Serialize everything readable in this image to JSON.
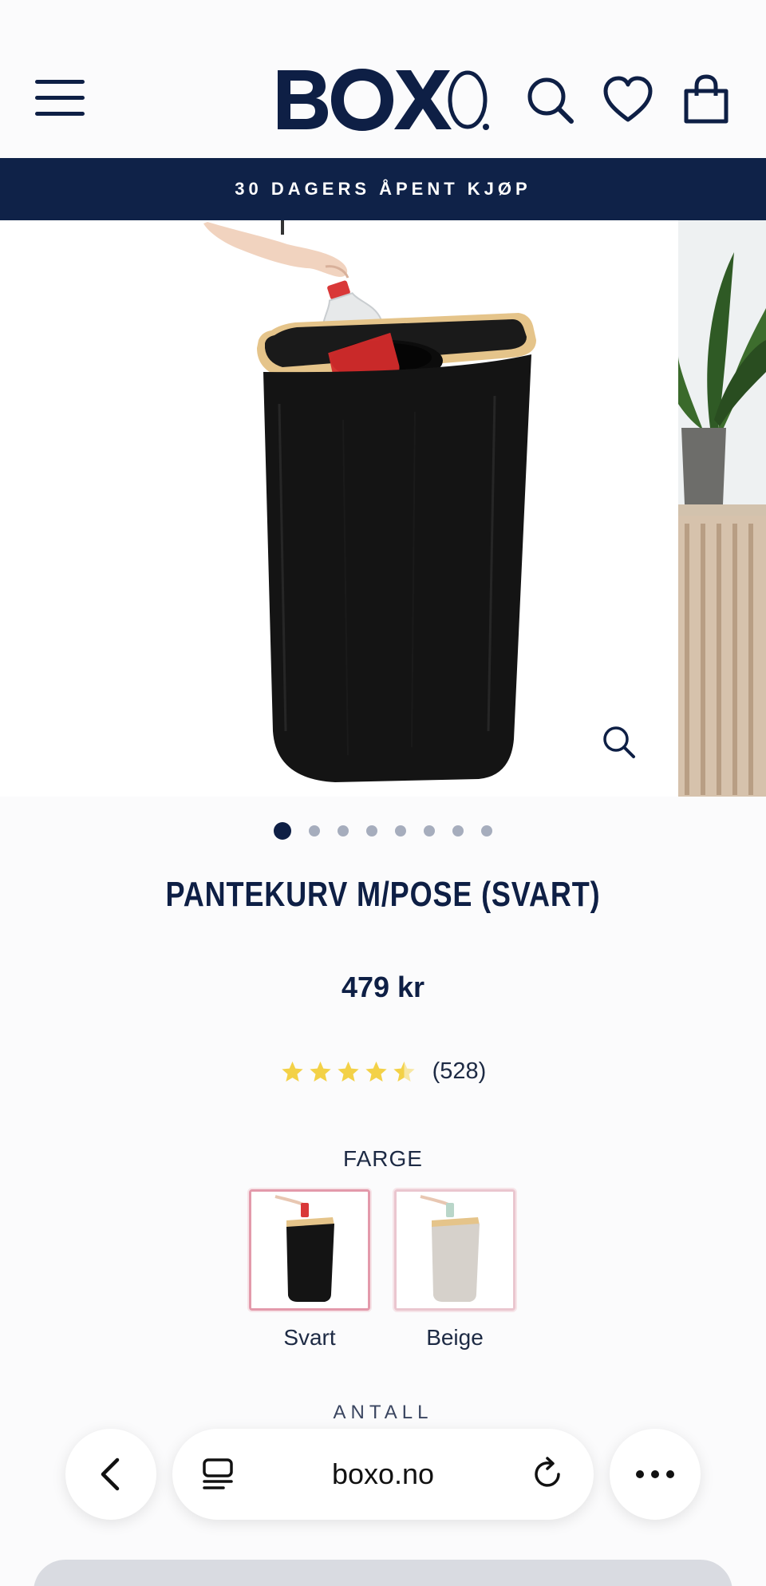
{
  "header": {
    "logo_text": "BOXO",
    "menu_icon": "hamburger-menu-icon",
    "search_icon": "search-icon",
    "wishlist_icon": "heart-icon",
    "cart_icon": "shopping-bag-icon"
  },
  "banner": {
    "text": "30 DAGERS ÅPENT KJØP"
  },
  "gallery": {
    "image_count": 8,
    "active_index": 0,
    "zoom_icon": "zoom-icon"
  },
  "product": {
    "title": "PANTEKURV M/POSE (SVART)",
    "price": "479 kr",
    "rating": 4.5,
    "review_count": "(528)"
  },
  "color_option": {
    "label": "FARGE",
    "options": [
      {
        "label": "Svart",
        "selected": true
      },
      {
        "label": "Beige",
        "selected": false
      }
    ]
  },
  "quantity": {
    "label": "ANTALL"
  },
  "browser": {
    "url": "boxo.no",
    "back_icon": "chevron-left-icon",
    "tabs_icon": "reader-icon",
    "reload_icon": "reload-icon",
    "more_icon": "more-icon"
  },
  "colors": {
    "navy": "#0e1f45",
    "star": "#f3d147",
    "banner": "#0f2248"
  }
}
